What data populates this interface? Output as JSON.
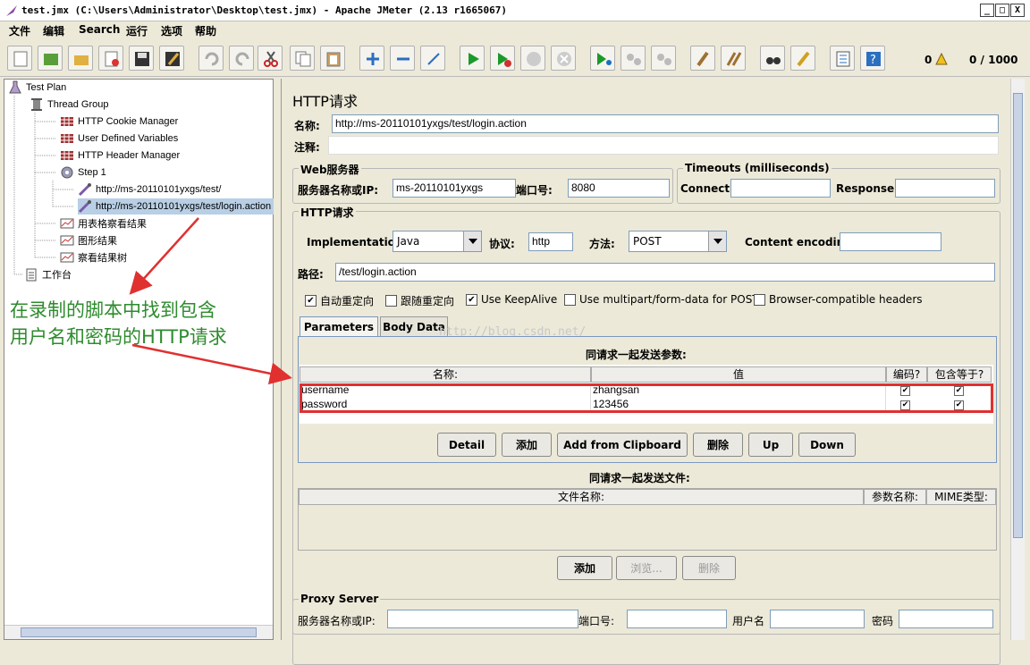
{
  "window": {
    "title": "test.jmx (C:\\Users\\Administrator\\Desktop\\test.jmx) - Apache JMeter (2.13 r1665067)",
    "min": "_",
    "max": "□",
    "close": "X"
  },
  "menu": [
    "文件",
    "编辑",
    "Search",
    "运行",
    "选项",
    "帮助"
  ],
  "status": {
    "warnings": "0",
    "threads": "0 / 1000"
  },
  "tree": {
    "test_plan": "Test Plan",
    "thread_group": "Thread Group",
    "cookie": "HTTP Cookie Manager",
    "udv": "User Defined Variables",
    "header": "HTTP Header Manager",
    "step1": "Step 1",
    "req1": "http://ms-20110101yxgs/test/",
    "req2": "http://ms-20110101yxgs/test/login.action",
    "table_view": "用表格察看结果",
    "graph": "图形结果",
    "result_tree": "察看结果树",
    "workbench": "工作台"
  },
  "annotation": {
    "line1": "在录制的脚本中找到包含",
    "line2": "用户名和密码的HTTP请求"
  },
  "panel": {
    "title": "HTTP请求",
    "name_label": "名称:",
    "name_value": "http://ms-20110101yxgs/test/login.action",
    "comment_label": "注释:",
    "web_server": "Web服务器",
    "server_label": "服务器名称或IP:",
    "server_value": "ms-20110101yxgs",
    "port_label": "端口号:",
    "port_value": "8080",
    "timeouts": "Timeouts (milliseconds)",
    "connect_label": "Connect:",
    "response_label": "Response:",
    "http_req": "HTTP请求",
    "impl_label": "Implementation:",
    "impl_value": "Java",
    "proto_label": "协议:",
    "proto_value": "http",
    "method_label": "方法:",
    "method_value": "POST",
    "enc_label": "Content encoding:",
    "path_label": "路径:",
    "path_value": "/test/login.action",
    "checkboxes": [
      {
        "label": "自动重定向",
        "checked": "✔"
      },
      {
        "label": "跟随重定向",
        "checked": ""
      },
      {
        "label": "Use KeepAlive",
        "checked": "✔"
      },
      {
        "label": "Use multipart/form-data for POST",
        "checked": ""
      },
      {
        "label": "Browser-compatible headers",
        "checked": ""
      }
    ],
    "tab_params": "Parameters",
    "tab_body": "Body Data",
    "watermark": "http://blog.csdn.net/",
    "params_caption": "同请求一起发送参数:",
    "col_name": "名称:",
    "col_value": "值",
    "col_encode": "编码?",
    "col_equals": "包含等于?",
    "params": [
      {
        "name": "username",
        "value": "zhangsan",
        "enc": "✔",
        "eq": "✔"
      },
      {
        "name": "password",
        "value": "123456",
        "enc": "✔",
        "eq": "✔"
      }
    ],
    "buttons": [
      "Detail",
      "添加",
      "Add from Clipboard",
      "删除",
      "Up",
      "Down"
    ],
    "files_caption": "同请求一起发送文件:",
    "col_filename": "文件名称:",
    "col_param": "参数名称:",
    "col_mime": "MIME类型:",
    "file_buttons": [
      "添加",
      "浏览...",
      "删除"
    ],
    "proxy": "Proxy Server",
    "proxy_server": "服务器名称或IP:",
    "proxy_port": "端口号:",
    "proxy_user": "用户名",
    "proxy_pass": "密码"
  },
  "colors": {
    "annotation": "#2e8b2e",
    "arrow": "#e03030",
    "selection": "#b8cfe5"
  }
}
